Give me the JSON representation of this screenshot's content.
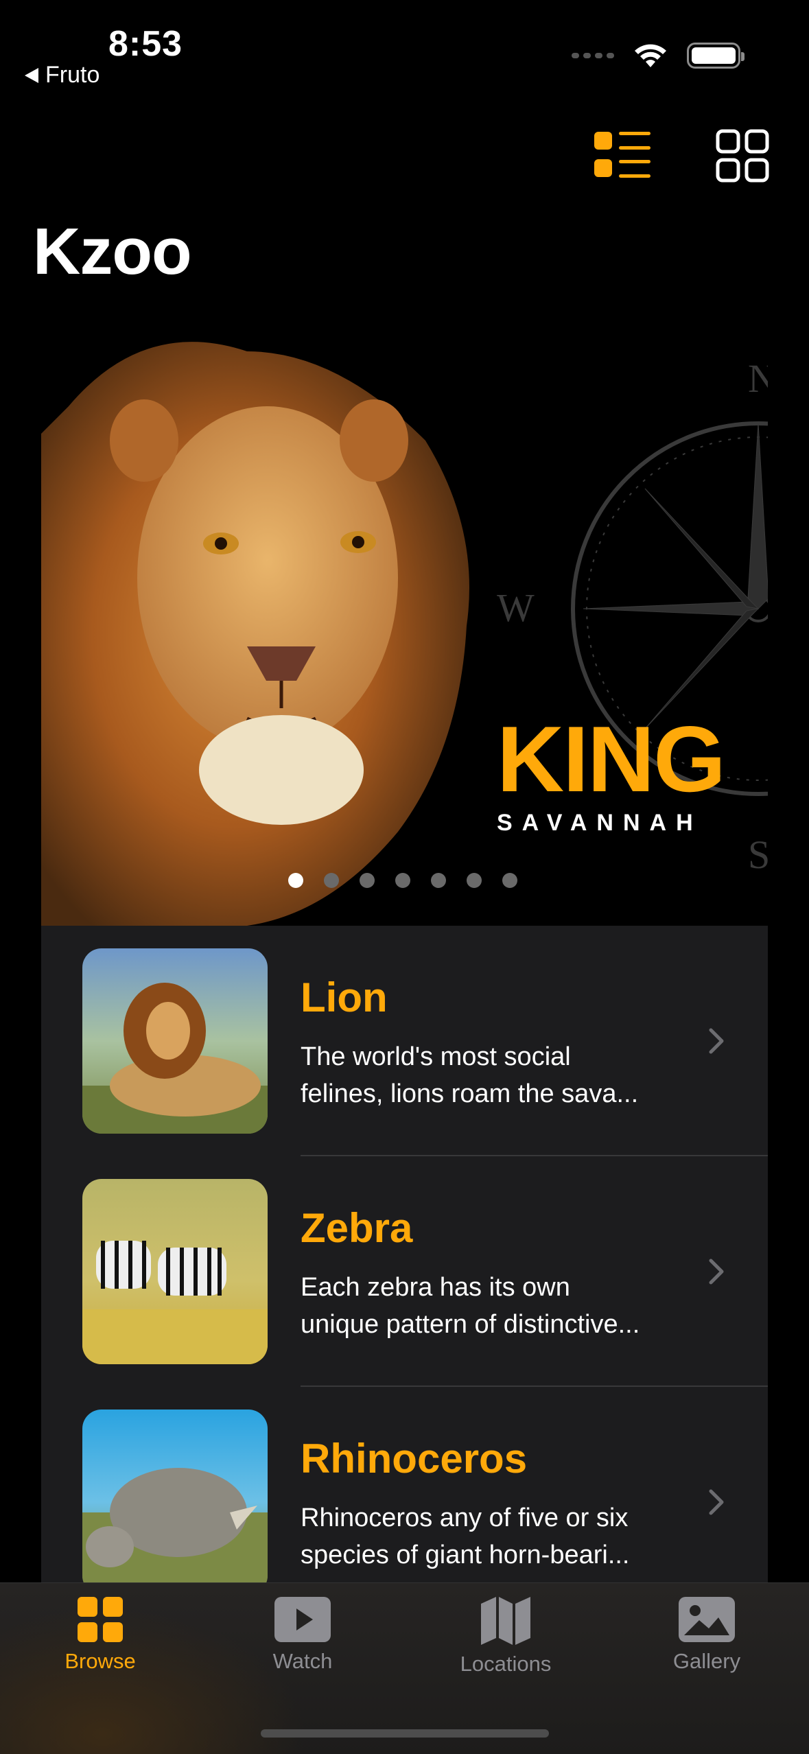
{
  "status_bar": {
    "time": "8:53",
    "back_app": "Fruto"
  },
  "header": {
    "title": "Kzoo"
  },
  "hero": {
    "title": "KING",
    "subtitle": "SAVANNAH",
    "page_count": 7,
    "active_page": 1,
    "compass_letters": [
      "N",
      "W",
      "S"
    ]
  },
  "animals": [
    {
      "name": "Lion",
      "desc_line1": "The world's most social",
      "desc_line2": "felines, lions roam the sava..."
    },
    {
      "name": "Zebra",
      "desc_line1": "Each zebra has its own",
      "desc_line2": "unique pattern of distinctive..."
    },
    {
      "name": "Rhinoceros",
      "desc_line1": "Rhinoceros any of five or six",
      "desc_line2": "species of giant horn-beari..."
    }
  ],
  "tabs": [
    {
      "label": "Browse",
      "icon": "grid-icon",
      "active": true
    },
    {
      "label": "Watch",
      "icon": "play-icon",
      "active": false
    },
    {
      "label": "Locations",
      "icon": "map-icon",
      "active": false
    },
    {
      "label": "Gallery",
      "icon": "photo-icon",
      "active": false
    }
  ],
  "colors": {
    "accent": "#ffa90a",
    "background": "#000000",
    "list_bg": "#1c1c1e",
    "inactive": "#8e8e93"
  }
}
